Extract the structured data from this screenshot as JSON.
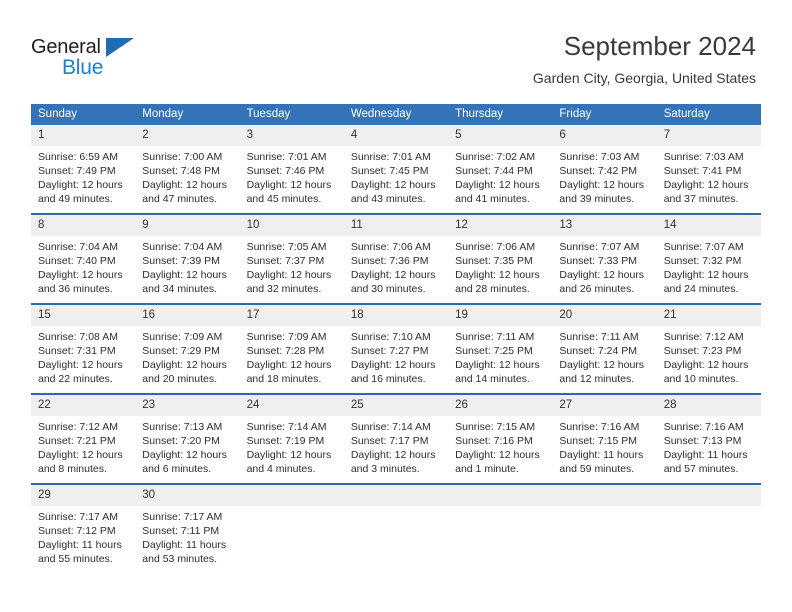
{
  "brand": {
    "name_part1": "General",
    "name_part2": "Blue",
    "triangle_icon": "triangle-icon",
    "accent_dark": "#231f20",
    "accent_blue": "#1b82d2",
    "logo_triangle_color": "#1f6cb5"
  },
  "header": {
    "title": "September 2024",
    "subtitle": "Garden City, Georgia, United States"
  },
  "theme": {
    "header_bg": "#3573b9",
    "row_rule": "#2b6ca8",
    "daynum_bg": "#efefef",
    "text": "#2e2e2e"
  },
  "calendar": {
    "weekday_headers": [
      "Sunday",
      "Monday",
      "Tuesday",
      "Wednesday",
      "Thursday",
      "Friday",
      "Saturday"
    ],
    "weeks": [
      [
        {
          "day": "1",
          "sunrise": "Sunrise: 6:59 AM",
          "sunset": "Sunset: 7:49 PM",
          "daylight_line1": "Daylight: 12 hours",
          "daylight_line2": "and 49 minutes."
        },
        {
          "day": "2",
          "sunrise": "Sunrise: 7:00 AM",
          "sunset": "Sunset: 7:48 PM",
          "daylight_line1": "Daylight: 12 hours",
          "daylight_line2": "and 47 minutes."
        },
        {
          "day": "3",
          "sunrise": "Sunrise: 7:01 AM",
          "sunset": "Sunset: 7:46 PM",
          "daylight_line1": "Daylight: 12 hours",
          "daylight_line2": "and 45 minutes."
        },
        {
          "day": "4",
          "sunrise": "Sunrise: 7:01 AM",
          "sunset": "Sunset: 7:45 PM",
          "daylight_line1": "Daylight: 12 hours",
          "daylight_line2": "and 43 minutes."
        },
        {
          "day": "5",
          "sunrise": "Sunrise: 7:02 AM",
          "sunset": "Sunset: 7:44 PM",
          "daylight_line1": "Daylight: 12 hours",
          "daylight_line2": "and 41 minutes."
        },
        {
          "day": "6",
          "sunrise": "Sunrise: 7:03 AM",
          "sunset": "Sunset: 7:42 PM",
          "daylight_line1": "Daylight: 12 hours",
          "daylight_line2": "and 39 minutes."
        },
        {
          "day": "7",
          "sunrise": "Sunrise: 7:03 AM",
          "sunset": "Sunset: 7:41 PM",
          "daylight_line1": "Daylight: 12 hours",
          "daylight_line2": "and 37 minutes."
        }
      ],
      [
        {
          "day": "8",
          "sunrise": "Sunrise: 7:04 AM",
          "sunset": "Sunset: 7:40 PM",
          "daylight_line1": "Daylight: 12 hours",
          "daylight_line2": "and 36 minutes."
        },
        {
          "day": "9",
          "sunrise": "Sunrise: 7:04 AM",
          "sunset": "Sunset: 7:39 PM",
          "daylight_line1": "Daylight: 12 hours",
          "daylight_line2": "and 34 minutes."
        },
        {
          "day": "10",
          "sunrise": "Sunrise: 7:05 AM",
          "sunset": "Sunset: 7:37 PM",
          "daylight_line1": "Daylight: 12 hours",
          "daylight_line2": "and 32 minutes."
        },
        {
          "day": "11",
          "sunrise": "Sunrise: 7:06 AM",
          "sunset": "Sunset: 7:36 PM",
          "daylight_line1": "Daylight: 12 hours",
          "daylight_line2": "and 30 minutes."
        },
        {
          "day": "12",
          "sunrise": "Sunrise: 7:06 AM",
          "sunset": "Sunset: 7:35 PM",
          "daylight_line1": "Daylight: 12 hours",
          "daylight_line2": "and 28 minutes."
        },
        {
          "day": "13",
          "sunrise": "Sunrise: 7:07 AM",
          "sunset": "Sunset: 7:33 PM",
          "daylight_line1": "Daylight: 12 hours",
          "daylight_line2": "and 26 minutes."
        },
        {
          "day": "14",
          "sunrise": "Sunrise: 7:07 AM",
          "sunset": "Sunset: 7:32 PM",
          "daylight_line1": "Daylight: 12 hours",
          "daylight_line2": "and 24 minutes."
        }
      ],
      [
        {
          "day": "15",
          "sunrise": "Sunrise: 7:08 AM",
          "sunset": "Sunset: 7:31 PM",
          "daylight_line1": "Daylight: 12 hours",
          "daylight_line2": "and 22 minutes."
        },
        {
          "day": "16",
          "sunrise": "Sunrise: 7:09 AM",
          "sunset": "Sunset: 7:29 PM",
          "daylight_line1": "Daylight: 12 hours",
          "daylight_line2": "and 20 minutes."
        },
        {
          "day": "17",
          "sunrise": "Sunrise: 7:09 AM",
          "sunset": "Sunset: 7:28 PM",
          "daylight_line1": "Daylight: 12 hours",
          "daylight_line2": "and 18 minutes."
        },
        {
          "day": "18",
          "sunrise": "Sunrise: 7:10 AM",
          "sunset": "Sunset: 7:27 PM",
          "daylight_line1": "Daylight: 12 hours",
          "daylight_line2": "and 16 minutes."
        },
        {
          "day": "19",
          "sunrise": "Sunrise: 7:11 AM",
          "sunset": "Sunset: 7:25 PM",
          "daylight_line1": "Daylight: 12 hours",
          "daylight_line2": "and 14 minutes."
        },
        {
          "day": "20",
          "sunrise": "Sunrise: 7:11 AM",
          "sunset": "Sunset: 7:24 PM",
          "daylight_line1": "Daylight: 12 hours",
          "daylight_line2": "and 12 minutes."
        },
        {
          "day": "21",
          "sunrise": "Sunrise: 7:12 AM",
          "sunset": "Sunset: 7:23 PM",
          "daylight_line1": "Daylight: 12 hours",
          "daylight_line2": "and 10 minutes."
        }
      ],
      [
        {
          "day": "22",
          "sunrise": "Sunrise: 7:12 AM",
          "sunset": "Sunset: 7:21 PM",
          "daylight_line1": "Daylight: 12 hours",
          "daylight_line2": "and 8 minutes."
        },
        {
          "day": "23",
          "sunrise": "Sunrise: 7:13 AM",
          "sunset": "Sunset: 7:20 PM",
          "daylight_line1": "Daylight: 12 hours",
          "daylight_line2": "and 6 minutes."
        },
        {
          "day": "24",
          "sunrise": "Sunrise: 7:14 AM",
          "sunset": "Sunset: 7:19 PM",
          "daylight_line1": "Daylight: 12 hours",
          "daylight_line2": "and 4 minutes."
        },
        {
          "day": "25",
          "sunrise": "Sunrise: 7:14 AM",
          "sunset": "Sunset: 7:17 PM",
          "daylight_line1": "Daylight: 12 hours",
          "daylight_line2": "and 3 minutes."
        },
        {
          "day": "26",
          "sunrise": "Sunrise: 7:15 AM",
          "sunset": "Sunset: 7:16 PM",
          "daylight_line1": "Daylight: 12 hours",
          "daylight_line2": "and 1 minute."
        },
        {
          "day": "27",
          "sunrise": "Sunrise: 7:16 AM",
          "sunset": "Sunset: 7:15 PM",
          "daylight_line1": "Daylight: 11 hours",
          "daylight_line2": "and 59 minutes."
        },
        {
          "day": "28",
          "sunrise": "Sunrise: 7:16 AM",
          "sunset": "Sunset: 7:13 PM",
          "daylight_line1": "Daylight: 11 hours",
          "daylight_line2": "and 57 minutes."
        }
      ],
      [
        {
          "day": "29",
          "sunrise": "Sunrise: 7:17 AM",
          "sunset": "Sunset: 7:12 PM",
          "daylight_line1": "Daylight: 11 hours",
          "daylight_line2": "and 55 minutes."
        },
        {
          "day": "30",
          "sunrise": "Sunrise: 7:17 AM",
          "sunset": "Sunset: 7:11 PM",
          "daylight_line1": "Daylight: 11 hours",
          "daylight_line2": "and 53 minutes."
        },
        {
          "day": "",
          "sunrise": "",
          "sunset": "",
          "daylight_line1": "",
          "daylight_line2": ""
        },
        {
          "day": "",
          "sunrise": "",
          "sunset": "",
          "daylight_line1": "",
          "daylight_line2": ""
        },
        {
          "day": "",
          "sunrise": "",
          "sunset": "",
          "daylight_line1": "",
          "daylight_line2": ""
        },
        {
          "day": "",
          "sunrise": "",
          "sunset": "",
          "daylight_line1": "",
          "daylight_line2": ""
        },
        {
          "day": "",
          "sunrise": "",
          "sunset": "",
          "daylight_line1": "",
          "daylight_line2": ""
        }
      ]
    ]
  }
}
